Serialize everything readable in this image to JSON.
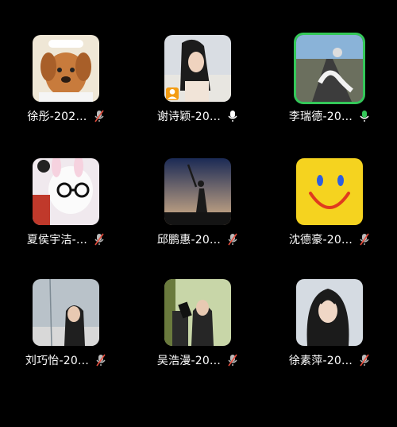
{
  "participants": [
    {
      "name": "徐彤-202…",
      "mic": "muted"
    },
    {
      "name": "谢诗颖-20…",
      "mic": "on",
      "host": true
    },
    {
      "name": "李瑞德-20…",
      "mic": "on",
      "speaking": true
    },
    {
      "name": "夏侯宇洁-…",
      "mic": "muted"
    },
    {
      "name": "邱鹏惠-20…",
      "mic": "muted"
    },
    {
      "name": "沈德豪-20…",
      "mic": "muted"
    },
    {
      "name": "刘巧怡-20…",
      "mic": "muted"
    },
    {
      "name": "吴浩漫-20…",
      "mic": "muted"
    },
    {
      "name": "徐素萍-20…",
      "mic": "muted"
    }
  ],
  "icons": {
    "mic_on": "microphone-icon",
    "mic_muted": "microphone-muted-icon",
    "host": "host-badge-icon"
  },
  "colors": {
    "background": "#000000",
    "speaking_border": "#34c759",
    "mute_slash": "#e74c3c",
    "host_badge": "#f39c12"
  }
}
